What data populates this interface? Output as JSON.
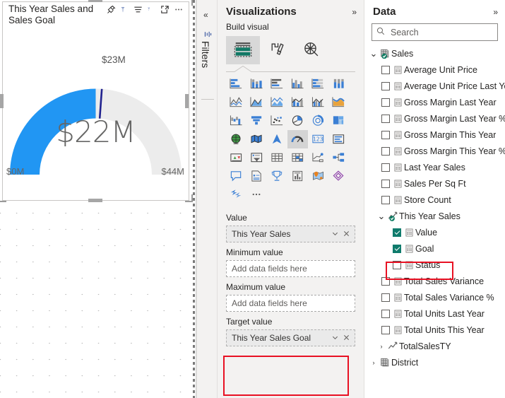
{
  "canvas": {
    "visual": {
      "title": "This Year Sales and\nSales Goal",
      "header_icons": [
        "pin-icon",
        "filter-icon",
        "sort-icon",
        "focus-mode-icon",
        "more-options-icon"
      ],
      "gauge": {
        "value_label": "$22M",
        "min_label": "$0M",
        "max_label": "$44M",
        "target_label": "$23M",
        "value": 22,
        "min": 0,
        "max": 44,
        "target": 23,
        "arc_color": "#2196f3",
        "track_color": "#ececec",
        "target_color": "#21228f"
      }
    }
  },
  "filters_rail": {
    "collapse_label": "«",
    "title": "Filters",
    "icon": "filter-icon"
  },
  "visualizations": {
    "title": "Visualizations",
    "expand_chevron": "»",
    "section_label": "Build visual",
    "tabs": [
      {
        "name": "build-visual-tab",
        "icon": "fields-icon",
        "selected": true
      },
      {
        "name": "format-visual-tab",
        "icon": "paintbrush-icon",
        "selected": false
      },
      {
        "name": "analytics-tab",
        "icon": "magnifier-chart-icon",
        "selected": false
      }
    ],
    "icons": [
      "stacked-bar-chart",
      "stacked-column-chart",
      "clustered-bar-chart",
      "clustered-column-chart",
      "100-stacked-bar-chart",
      "100-stacked-column-chart",
      "line-chart",
      "area-chart",
      "stacked-area-chart",
      "line-and-stacked-column-chart",
      "line-and-clustered-column-chart",
      "ribbon-chart",
      "waterfall-chart",
      "funnel-chart",
      "scatter-chart",
      "pie-chart",
      "donut-chart",
      "treemap",
      "map",
      "filled-map",
      "azure-map",
      "gauge",
      "card",
      "multi-row-card",
      "kpi",
      "slicer",
      "table",
      "matrix",
      "r-script-visual",
      "decomposition-tree",
      "q-and-a",
      "paginated-report",
      "key-influencers",
      "smart-narrative",
      "arcgis-map",
      "power-apps",
      "power-automate",
      "more-visuals"
    ],
    "selected_icon": "gauge",
    "wells": [
      {
        "label": "Value",
        "value": "This Year Sales",
        "placeholder": "Add data fields here",
        "filled": true
      },
      {
        "label": "Minimum value",
        "value": "",
        "placeholder": "Add data fields here",
        "filled": false
      },
      {
        "label": "Maximum value",
        "value": "",
        "placeholder": "Add data fields here",
        "filled": false
      },
      {
        "label": "Target value",
        "value": "This Year Sales Goal",
        "placeholder": "Add data fields here",
        "filled": true
      }
    ],
    "highlight_color": "#e81123"
  },
  "data": {
    "title": "Data",
    "expand_chevron": "»",
    "search": {
      "placeholder": "Search",
      "value": ""
    },
    "tree": [
      {
        "level": "table",
        "caret": "∨",
        "icon": "table-icon-checked",
        "label": "Sales",
        "checkbox": null
      },
      {
        "level": "field",
        "caret": "",
        "icon": "measure-icon",
        "label": "Average Unit Price",
        "checkbox": false
      },
      {
        "level": "field",
        "caret": "",
        "icon": "measure-icon",
        "label": "Average Unit Price Last Year",
        "checkbox": false
      },
      {
        "level": "field",
        "caret": "",
        "icon": "measure-icon",
        "label": "Gross Margin Last Year",
        "checkbox": false
      },
      {
        "level": "field",
        "caret": "",
        "icon": "measure-icon",
        "label": "Gross Margin Last Year %",
        "checkbox": false
      },
      {
        "level": "field",
        "caret": "",
        "icon": "measure-icon",
        "label": "Gross Margin This Year",
        "checkbox": false
      },
      {
        "level": "field",
        "caret": "",
        "icon": "measure-icon",
        "label": "Gross Margin This Year %",
        "checkbox": false
      },
      {
        "level": "field",
        "caret": "",
        "icon": "measure-icon",
        "label": "Last Year Sales",
        "checkbox": false
      },
      {
        "level": "field",
        "caret": "",
        "icon": "measure-icon",
        "label": "Sales Per Sq Ft",
        "checkbox": false
      },
      {
        "level": "field",
        "caret": "",
        "icon": "measure-icon",
        "label": "Store Count",
        "checkbox": false
      },
      {
        "level": "sub",
        "caret": "∨",
        "icon": "folder-measure-checked",
        "label": "This Year Sales",
        "checkbox": null
      },
      {
        "level": "subfield",
        "caret": "",
        "icon": "measure-icon",
        "label": "Value",
        "checkbox": true
      },
      {
        "level": "subfield",
        "caret": "",
        "icon": "measure-icon",
        "label": "Goal",
        "checkbox": true,
        "highlighted": true
      },
      {
        "level": "subfield",
        "caret": "",
        "icon": "measure-icon",
        "label": "Status",
        "checkbox": false
      },
      {
        "level": "field",
        "caret": "",
        "icon": "measure-icon",
        "label": "Total Sales Variance",
        "checkbox": false
      },
      {
        "level": "field",
        "caret": "",
        "icon": "measure-icon",
        "label": "Total Sales Variance %",
        "checkbox": false
      },
      {
        "level": "field",
        "caret": "",
        "icon": "measure-icon",
        "label": "Total Units Last Year",
        "checkbox": false
      },
      {
        "level": "field",
        "caret": "",
        "icon": "measure-icon",
        "label": "Total Units This Year",
        "checkbox": false
      },
      {
        "level": "sub",
        "caret": ">",
        "icon": "folder-measure-icon",
        "label": "TotalSalesTY",
        "checkbox": null
      },
      {
        "level": "table",
        "caret": ">",
        "icon": "table-icon",
        "label": "District",
        "checkbox": null
      }
    ]
  }
}
